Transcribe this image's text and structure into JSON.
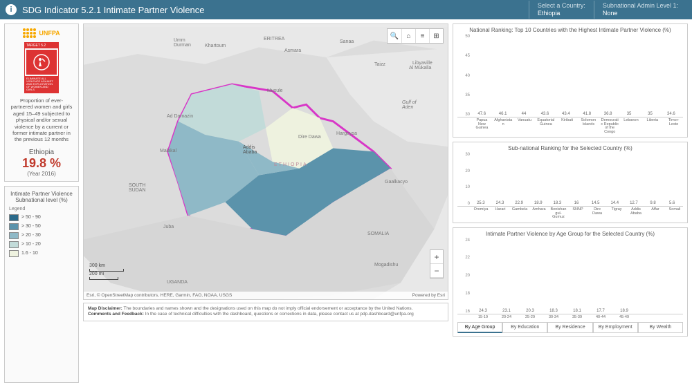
{
  "header": {
    "title": "SDG Indicator 5.2.1 Intimate Partner Violence",
    "country_label": "Select a Country:",
    "country_value": "Ethiopia",
    "admin_label": "Subnational Admin Level 1:",
    "admin_value": "None"
  },
  "info": {
    "unfpa": "UNFPA",
    "target": "TARGET  5.2",
    "target_text": "ELIMINATE ALL VIOLENCE AGAINST AND EXPLOITATION OF WOMEN AND GIRLS",
    "description": "Proportion of ever-partnered women and girls aged 15–49 subjected to physical and/or sexual violence by a current or former intimate partner in the previous 12 months",
    "country": "Ethiopia",
    "percent": "19.8 %",
    "year": "(Year 2016)"
  },
  "legend": {
    "title": "Intimate Partner Violence Subnational level (%)",
    "sub": "Legend",
    "items": [
      {
        "label": "> 50 - 90",
        "color": "#2b6a8a"
      },
      {
        "label": "> 30 - 50",
        "color": "#5b93ab"
      },
      {
        "label": "> 20 - 30",
        "color": "#8fb9c7"
      },
      {
        "label": "> 10 - 20",
        "color": "#c2dbd9"
      },
      {
        "label": "1.6 - 10",
        "color": "#eef2df"
      }
    ]
  },
  "map": {
    "attrib_left": "Esri, © OpenStreetMap contributors, HERE, Garmin, FAO, NOAA, USGS",
    "attrib_right": "Powered by Esri",
    "scale1": "300 km",
    "scale2": "200 mi",
    "labels": [
      "Sanaa",
      "ERITREA",
      "Asmara",
      "Umm Durman",
      "Khartoum",
      "Al Mukalla",
      "Gulf of Aden",
      "Taizz",
      "Ad Damazin",
      "Malakal",
      "SOUTH SUDAN",
      "Juba",
      "Addis Ababa",
      "ETHIOPIA",
      "Dire Dawa",
      "Hargeysa",
      "SOMALIA",
      "Mogadishu",
      "UGANDA",
      "Gaalkacyo",
      "Libyaville",
      "Musule"
    ]
  },
  "disclaimer": {
    "l1b": "Map Disclaimer:",
    "l1": " The boundaries and names shown and the designations used on this map do not imply official endorsement or acceptance by the United Nations.",
    "l2b": "Comments and Feedback:",
    "l2": " In the case of technical difficulties with the dashboard, questions or corrections in data, please contact us at pdp.dashboard@unfpa.org"
  },
  "chart_data": [
    {
      "type": "bar",
      "title": "National Ranking: Top 10 Countries with the Highest Intimate Partner Violence (%)",
      "color": "#c93a2e",
      "ylim": [
        30,
        50
      ],
      "ticks": [
        30,
        35,
        40,
        45,
        50
      ],
      "categories": [
        "Papua New Guinea",
        "Afghanistan",
        "Vanuatu",
        "Equatorial Guinea",
        "Kiribati",
        "Solomon Islands",
        "Democratic Republic of the Congo",
        "Lebanon",
        "Liberia",
        "Timor-Leste"
      ],
      "values": [
        47.6,
        46.1,
        44,
        43.6,
        43.4,
        41.8,
        36.8,
        35,
        35,
        34.6
      ]
    },
    {
      "type": "bar",
      "title": "Sub-national Ranking for the Selected Country (%)",
      "color": "#3b728f",
      "ylim": [
        0,
        30
      ],
      "ticks": [
        0,
        10,
        20,
        30
      ],
      "categories": [
        "Oromiya",
        "Harari",
        "Gambela",
        "Amhara",
        "Benishangul-Gumuz",
        "SNNP",
        "Dire Dawa",
        "Tigray",
        "Addis Ababa",
        "Affar",
        "Somali"
      ],
      "values": [
        25.3,
        24.3,
        22.9,
        18.9,
        18.3,
        16,
        14.5,
        14.4,
        12.7,
        9.8,
        5.6
      ]
    },
    {
      "type": "bar",
      "title": "Intimate Partner Violence by Age Group for the Selected Country (%)",
      "ylim": [
        16,
        26
      ],
      "ticks": [
        16,
        18,
        20,
        22,
        24
      ],
      "categories": [
        "15-19",
        "20-24",
        "25-29",
        "30-34",
        "35-39",
        "40-44",
        "45-49"
      ],
      "values": [
        24.3,
        23.1,
        20.3,
        18.3,
        18.1,
        17.7,
        18.9
      ],
      "colors": [
        "#2c5a73",
        "#7b4b9a",
        "#4a9fc9",
        "#3a6e5a",
        "#c9a24a",
        "#6fc6e8",
        "#2e6fe8"
      ],
      "tabs": [
        "By Age Group",
        "By Education",
        "By Residence",
        "By Employment",
        "By Wealth"
      ],
      "active_tab": 0
    }
  ]
}
